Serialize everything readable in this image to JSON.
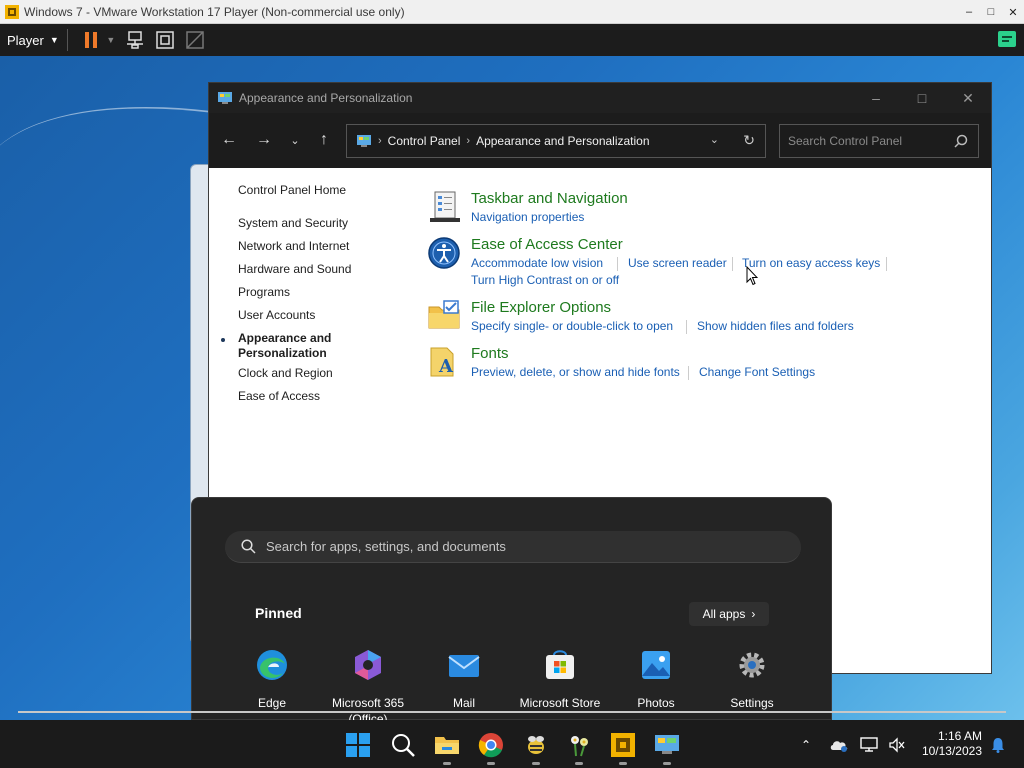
{
  "vmware": {
    "title": "Windows 7 - VMware Workstation 17 Player (Non-commercial use only)",
    "player_menu": "Player"
  },
  "control_panel": {
    "window_title": "Appearance and Personalization",
    "address": {
      "part1": "Control Panel",
      "part2": "Appearance and Personalization"
    },
    "search_placeholder": "Search Control Panel",
    "left_nav": {
      "home": "Control Panel Home",
      "system_security": "System and Security",
      "network_internet": "Network and Internet",
      "hardware_sound": "Hardware and Sound",
      "programs": "Programs",
      "user_accounts": "User Accounts",
      "appearance_line1": "Appearance and",
      "appearance_line2": "Personalization",
      "clock_region": "Clock and Region",
      "ease_of_access": "Ease of Access"
    },
    "categories": {
      "taskbar": {
        "title": "Taskbar and Navigation",
        "link1": "Navigation properties"
      },
      "ease": {
        "title": "Ease of Access Center",
        "link1": "Accommodate low vision",
        "link2": "Use screen reader",
        "link3": "Turn on easy access keys",
        "link4": "Turn High Contrast on or off"
      },
      "explorer": {
        "title": "File Explorer Options",
        "link1": "Specify single- or double-click to open",
        "link2": "Show hidden files and folders"
      },
      "fonts": {
        "title": "Fonts",
        "link1": "Preview, delete, or show and hide fonts",
        "link2": "Change Font Settings"
      }
    }
  },
  "start_menu": {
    "search_placeholder": "Search for apps, settings, and documents",
    "pinned_label": "Pinned",
    "all_apps_label": "All apps",
    "pinned": {
      "edge": "Edge",
      "m365_line1": "Microsoft 365",
      "m365_line2": "(Office)",
      "mail": "Mail",
      "store": "Microsoft Store",
      "photos": "Photos",
      "settings": "Settings"
    }
  },
  "taskbar": {
    "time": "1:16 AM",
    "date": "10/13/2023"
  },
  "colors": {
    "link_blue": "#1a5fb4",
    "category_green": "#1e7a1e",
    "win11_blue": "#0078d4"
  }
}
